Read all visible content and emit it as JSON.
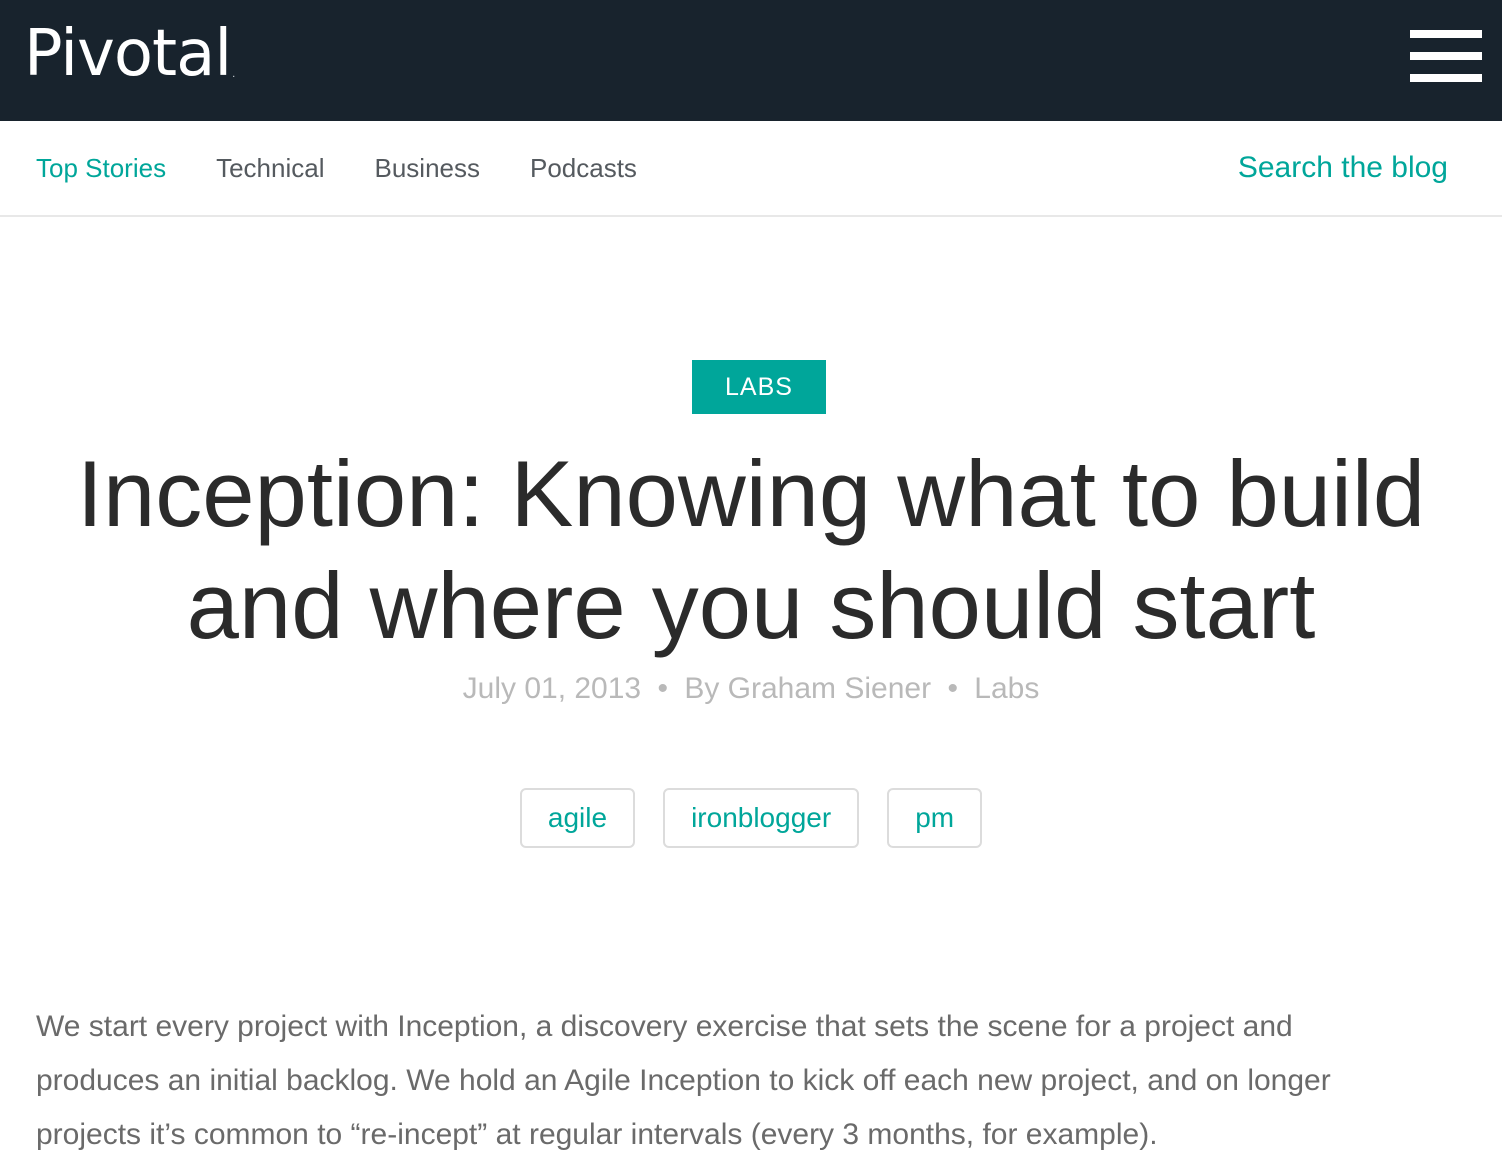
{
  "header": {
    "logo_text": "Pivotal",
    "logo_mark": ".",
    "menu_icon": "hamburger-menu-icon"
  },
  "subnav": {
    "items": [
      {
        "label": "Top Stories",
        "active": true
      },
      {
        "label": "Technical",
        "active": false
      },
      {
        "label": "Business",
        "active": false
      },
      {
        "label": "Podcasts",
        "active": false
      }
    ],
    "search_label": "Search the blog"
  },
  "article": {
    "category": "LABS",
    "title_line1": "Inception: Knowing what to build",
    "title_line2": "and where you should start",
    "date": "July 01, 2013",
    "separator": "•",
    "author": "By Graham Siener",
    "category_meta": "Labs",
    "tags": [
      "agile",
      "ironblogger",
      "pm"
    ],
    "body_lines": [
      "We start every project with Inception, a discovery exercise that sets the scene for a project and",
      "produces an initial backlog.  We hold an Agile Inception to kick off each new project, and on longer",
      "projects it’s common to “re-incept” at regular intervals (every 3 months, for example)."
    ]
  },
  "colors": {
    "topbar_bg": "#18232d",
    "accent": "#00a69a",
    "title_text": "#2b2b2b",
    "meta_text": "#b9b9b9",
    "body_text": "#6a6a6a"
  }
}
